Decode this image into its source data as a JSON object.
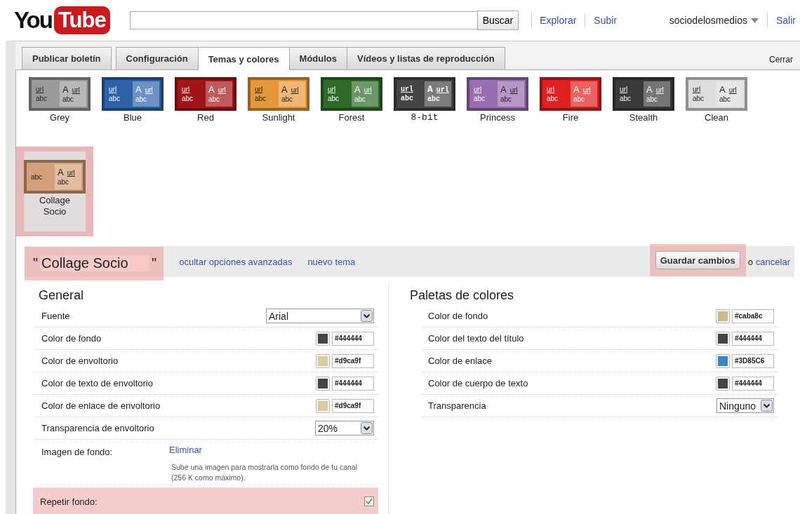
{
  "header": {
    "logo": {
      "part1": "You",
      "part2": "Tube"
    },
    "search": {
      "button": "Buscar"
    },
    "links": [
      "Explorar",
      "Subir"
    ],
    "user": "sociodelosmedios",
    "signout": "Salir"
  },
  "tabs": [
    {
      "label": "Publicar boletín",
      "selected": false
    },
    {
      "label": "Configuración",
      "selected": false
    },
    {
      "label": "Temas y colores",
      "selected": true
    },
    {
      "label": "Módulos",
      "selected": false
    },
    {
      "label": "Vídeos y listas de reproducción",
      "selected": false
    }
  ],
  "close": "Cerrar",
  "themes": [
    {
      "name": "Grey",
      "kind": "standard",
      "color": "#9a9a9a",
      "selected": false,
      "highlighted": false,
      "preview": {
        "left_link": "url",
        "left_text": "abc",
        "title": "A",
        "right_link": "url",
        "right_text": "abc"
      }
    },
    {
      "name": "Blue",
      "kind": "standard",
      "color": "#2e62a8",
      "selected": false,
      "highlighted": false,
      "preview": {
        "left_link": "url",
        "left_text": "abc",
        "title": "A",
        "right_link": "url",
        "right_text": "abc"
      }
    },
    {
      "name": "Red",
      "kind": "standard",
      "color": "#a31418",
      "selected": false,
      "highlighted": false,
      "preview": {
        "left_link": "url",
        "left_text": "abc",
        "title": "A",
        "right_link": "url",
        "right_text": "abc"
      }
    },
    {
      "name": "Sunlight",
      "kind": "standard",
      "color": "#e8963a",
      "selected": false,
      "highlighted": false,
      "preview": {
        "left_link": "url",
        "left_text": "abc",
        "title": "A",
        "right_link": "url",
        "right_text": "abc"
      }
    },
    {
      "name": "Forest",
      "kind": "standard",
      "color": "#306a28",
      "selected": false,
      "highlighted": false,
      "preview": {
        "left_link": "url",
        "left_text": "abc",
        "title": "A",
        "right_link": "url",
        "right_text": "abc"
      }
    },
    {
      "name": "8-bit",
      "kind": "monospace",
      "color": "#444444",
      "selected": false,
      "highlighted": false,
      "preview": {
        "left_link": "url",
        "left_text": "abc",
        "title": "A",
        "right_link": "url",
        "right_text": "abc"
      }
    },
    {
      "name": "Princess",
      "kind": "standard",
      "color": "#9a6cb0",
      "selected": false,
      "highlighted": false,
      "preview": {
        "left_link": "url",
        "left_text": "abc",
        "title": "A",
        "right_link": "url",
        "right_text": "abc"
      }
    },
    {
      "name": "Fire",
      "kind": "standard",
      "color": "#e02020",
      "selected": false,
      "highlighted": false,
      "preview": {
        "left_link": "url",
        "left_text": "abc",
        "title": "A",
        "right_link": "url",
        "right_text": "abc"
      }
    },
    {
      "name": "Stealth",
      "kind": "standard",
      "color": "#3a3a3a",
      "selected": false,
      "highlighted": false,
      "preview": {
        "left_link": "url",
        "left_text": "abc",
        "title": "A",
        "right_link": "url",
        "right_text": "abc"
      }
    },
    {
      "name": "Clean",
      "kind": "standard",
      "color": "#dddddd",
      "selected": false,
      "highlighted": false,
      "preview": {
        "left_link": "url",
        "left_text": "abc",
        "title": "A",
        "right_link": "url",
        "right_text": "abc"
      }
    },
    {
      "name": "Collage Socio",
      "kind": "standard",
      "color": "#d4a07a",
      "selected": true,
      "highlighted": true,
      "preview": {
        "left_text": "abc",
        "title": "A",
        "right_link": "url",
        "right_text": "abc"
      }
    }
  ],
  "theme_bar": {
    "open_quote": "\"",
    "name": "Collage Socio",
    "close_quote": "\"",
    "name_highlighted": true,
    "links": [
      "ocultar opciones avanzadas",
      "nuevo tema"
    ],
    "save": "Guardar cambios",
    "save_highlighted": true,
    "or_text": "o",
    "cancel": "cancelar"
  },
  "general": {
    "title": "General",
    "rows": [
      {
        "kind": "select",
        "label": "Fuente",
        "value": "Arial",
        "highlighted": false
      },
      {
        "kind": "color",
        "label": "Color de fondo",
        "value": "#444444",
        "color": "#444444",
        "highlighted": false
      },
      {
        "kind": "color",
        "label": "Color de envoltorio",
        "value": "#d9ca9f",
        "color": "#d9ca9f",
        "highlighted": false
      },
      {
        "kind": "color",
        "label": "Color de texto de envoltorio",
        "value": "#444444",
        "color": "#444444",
        "highlighted": false
      },
      {
        "kind": "color",
        "label": "Color de enlace de envoltorio",
        "value": "#d9ca9f",
        "color": "#d9ca9f",
        "highlighted": false
      },
      {
        "kind": "select",
        "label": "Transparencia de envoltorio",
        "value": "20%",
        "highlighted": false
      },
      {
        "kind": "image",
        "label": "Imagen de fondo:",
        "link": "Eliminar",
        "help": "Sube una imagen para mostrarla como fondo de tu canal (256 K como máximo).",
        "highlighted": false
      },
      {
        "kind": "checkbox",
        "label": "Repetir fondo:",
        "checked": true,
        "highlighted": true
      }
    ]
  },
  "palettes": {
    "title": "Paletas de colores",
    "rows": [
      {
        "kind": "color",
        "label": "Color de fondo",
        "value": "#caba8c",
        "color": "#caba8c",
        "highlighted": false
      },
      {
        "kind": "color",
        "label": "Color del texto del título",
        "value": "#444444",
        "color": "#444444",
        "highlighted": false
      },
      {
        "kind": "color",
        "label": "Color de enlace",
        "value": "#3D85C6",
        "color": "#3d85c6",
        "highlighted": false
      },
      {
        "kind": "color",
        "label": "Color de cuerpo de texto",
        "value": "#444444",
        "color": "#444444",
        "highlighted": false
      },
      {
        "kind": "select",
        "label": "Transparencia",
        "value": "Ninguno",
        "highlighted": false
      }
    ]
  }
}
